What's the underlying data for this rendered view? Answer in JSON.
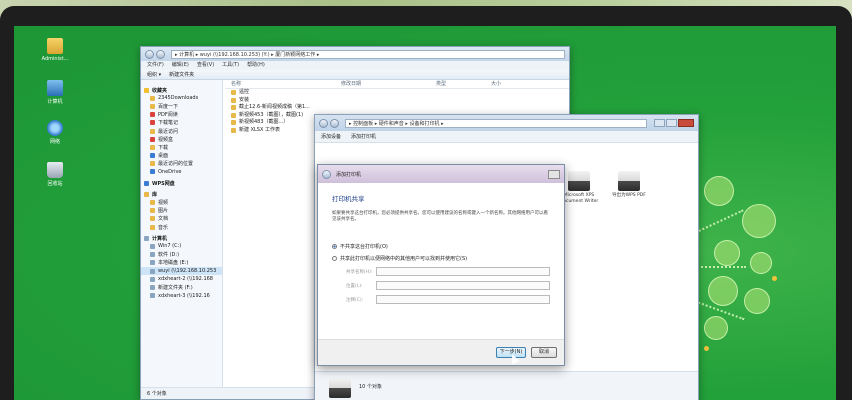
{
  "desktop": {
    "icons": [
      {
        "label": "Administ...",
        "icon": "user-folder-icon"
      },
      {
        "label": "计算机",
        "icon": "computer-icon"
      },
      {
        "label": "网络",
        "icon": "network-icon"
      },
      {
        "label": "回收站",
        "icon": "recycle-bin-icon"
      }
    ]
  },
  "explorer": {
    "address": "▸ 计算机 ▸ wuyi (\\\\192.168.10.253) (Y:) ▸ 厦门新颖网络工作 ▸",
    "menu": [
      "文件(F)",
      "编辑(E)",
      "查看(V)",
      "工具(T)",
      "帮助(H)"
    ],
    "toolbar": [
      "组织 ▾",
      "新建文件夹"
    ],
    "sidebar": [
      {
        "label": "收藏夹",
        "head": true,
        "icon": "star"
      },
      {
        "label": "2345Downloads",
        "icon": "folder"
      },
      {
        "label": "百度一下",
        "icon": "folder"
      },
      {
        "label": "PDF阅读",
        "icon": "red"
      },
      {
        "label": "下载笔记",
        "icon": "red"
      },
      {
        "label": "最近访问",
        "icon": "folder"
      },
      {
        "label": "视频盒",
        "icon": "red"
      },
      {
        "label": "下载",
        "icon": "folder"
      },
      {
        "label": "桌面",
        "icon": "blue"
      },
      {
        "label": "最近访问的位置",
        "icon": "folder"
      },
      {
        "label": "OneDrive",
        "icon": "blue"
      },
      {
        "label": "WPS网盘",
        "head": true,
        "icon": "blue"
      },
      {
        "label": "库",
        "head": true,
        "icon": "folder"
      },
      {
        "label": "视频",
        "icon": "folder"
      },
      {
        "label": "图片",
        "icon": "folder"
      },
      {
        "label": "文档",
        "icon": "folder"
      },
      {
        "label": "音乐",
        "icon": "folder"
      },
      {
        "label": "计算机",
        "head": true,
        "icon": "drive"
      },
      {
        "label": "Win7 (C:)",
        "icon": "drive"
      },
      {
        "label": "软件 (D:)",
        "icon": "drive"
      },
      {
        "label": "本地磁盘 (E:)",
        "icon": "drive"
      },
      {
        "label": "wuyi (\\\\192.168.10.253",
        "icon": "drive",
        "selected": true
      },
      {
        "label": "xdxheart-2 (\\\\192.168",
        "icon": "drive"
      },
      {
        "label": "新建文件夹 (F:)",
        "icon": "drive"
      },
      {
        "label": "xdxheart-3 (\\\\192.16",
        "icon": "drive"
      }
    ],
    "columns": [
      "名称",
      "修改日期",
      "类型",
      "大小"
    ],
    "files": [
      {
        "name": "遥控",
        "icon": "folder"
      },
      {
        "name": "安装",
        "icon": "folder"
      },
      {
        "name": "截止12.6-新闻视频成稿（第1...",
        "icon": "folder"
      },
      {
        "name": "新视频453（截图），截图(1)",
        "icon": "folder"
      },
      {
        "name": "新视频483（截图...）",
        "icon": "folder"
      },
      {
        "name": "新建 XLSX 工作表",
        "icon": "folder"
      }
    ],
    "status": "6 个对象"
  },
  "devices": {
    "address": "▸ 控制面板 ▸ 硬件和声音 ▸ 设备和打印机 ▸",
    "toolbar": [
      "添加设备",
      "添加打印机"
    ],
    "printers": [
      {
        "name": "Microsoft XPS Document Writer"
      },
      {
        "name": "导出为WPS PDF"
      }
    ],
    "status": "10 个对象"
  },
  "wizard": {
    "window_title": "添加打印机",
    "heading": "打印机共享",
    "description": "如果要共享这台打印机，您必须提供共享名。您可以使用建议的名称或键入一个新名称。其他网络用户可以看见该共享名。",
    "option_no_share": "不共享这台打印机(O)",
    "option_share": "共享此打印机以便网络中的其他用户可以找到并使用它(S)",
    "share_name_label": "共享名称(H):",
    "location_label": "位置(L):",
    "comment_label": "注释(C):",
    "next_label": "下一步(N)",
    "cancel_label": "取消"
  }
}
